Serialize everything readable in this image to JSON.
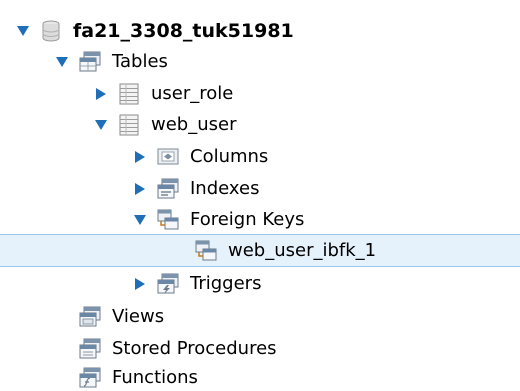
{
  "tree": {
    "schema": {
      "label": "fa21_3308_tuk51981",
      "icon": "database-icon",
      "expanded": true
    },
    "tables": {
      "label": "Tables",
      "icon": "folder-tables-icon",
      "expanded": true
    },
    "user_role": {
      "label": "user_role",
      "icon": "table-icon",
      "expanded": false
    },
    "web_user": {
      "label": "web_user",
      "icon": "table-icon",
      "expanded": true
    },
    "columns": {
      "label": "Columns",
      "icon": "columns-folder-icon",
      "expanded": false
    },
    "indexes": {
      "label": "Indexes",
      "icon": "indexes-folder-icon",
      "expanded": false
    },
    "foreign_keys": {
      "label": "Foreign Keys",
      "icon": "foreign-keys-folder-icon",
      "expanded": true
    },
    "fk_item": {
      "label": "web_user_ibfk_1",
      "icon": "foreign-key-icon",
      "selected": true
    },
    "triggers": {
      "label": "Triggers",
      "icon": "triggers-folder-icon",
      "expanded": false
    },
    "views": {
      "label": "Views",
      "icon": "views-folder-icon"
    },
    "procedures": {
      "label": "Stored Procedures",
      "icon": "procedures-folder-icon"
    },
    "functions": {
      "label": "Functions",
      "icon": "functions-folder-icon"
    }
  },
  "colors": {
    "selection_bg": "#e5f1fb",
    "selection_border": "#99c9ef",
    "arrow": "#1e6fb8"
  }
}
